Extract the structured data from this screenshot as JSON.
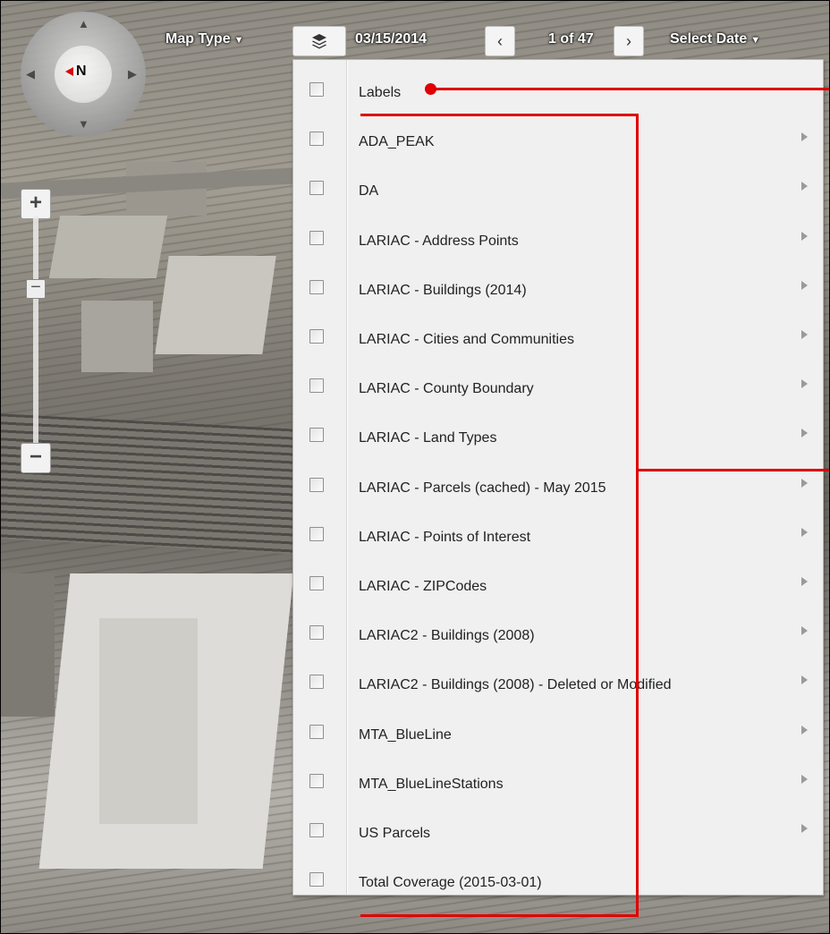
{
  "toolbar": {
    "map_type_label": "Map Type",
    "layers_icon": "layers-icon",
    "date": "03/15/2014",
    "prev_icon": "chevron-left-icon",
    "page_indicator": "1 of 47",
    "next_icon": "chevron-right-icon",
    "select_date_label": "Select Date"
  },
  "compass": {
    "north_label": "N"
  },
  "zoom": {
    "in_label": "+",
    "out_label": "−",
    "handle_label": "−"
  },
  "layers": [
    {
      "label": "Labels",
      "checked": false,
      "has_submenu": false
    },
    {
      "label": "ADA_PEAK",
      "checked": false,
      "has_submenu": true
    },
    {
      "label": "DA",
      "checked": false,
      "has_submenu": true
    },
    {
      "label": "LARIAC - Address Points",
      "checked": false,
      "has_submenu": true
    },
    {
      "label": "LARIAC - Buildings (2014)",
      "checked": false,
      "has_submenu": true
    },
    {
      "label": "LARIAC - Cities and Communities",
      "checked": false,
      "has_submenu": true
    },
    {
      "label": "LARIAC - County Boundary",
      "checked": false,
      "has_submenu": true
    },
    {
      "label": "LARIAC - Land Types",
      "checked": false,
      "has_submenu": true
    },
    {
      "label": "LARIAC - Parcels (cached) - May 2015",
      "checked": false,
      "has_submenu": true
    },
    {
      "label": "LARIAC - Points of Interest",
      "checked": false,
      "has_submenu": true
    },
    {
      "label": "LARIAC - ZIPCodes",
      "checked": false,
      "has_submenu": true
    },
    {
      "label": "LARIAC2 - Buildings (2008)",
      "checked": false,
      "has_submenu": true
    },
    {
      "label": "LARIAC2 - Buildings (2008) - Deleted or Modified",
      "checked": false,
      "has_submenu": true
    },
    {
      "label": "MTA_BlueLine",
      "checked": false,
      "has_submenu": true
    },
    {
      "label": "MTA_BlueLineStations",
      "checked": false,
      "has_submenu": true
    },
    {
      "label": "US Parcels",
      "checked": false,
      "has_submenu": true
    },
    {
      "label": "Total Coverage (2015-03-01)",
      "checked": false,
      "has_submenu": false
    }
  ],
  "colors": {
    "annotation": "#e00000",
    "menu_bg": "#f0f0f0"
  }
}
